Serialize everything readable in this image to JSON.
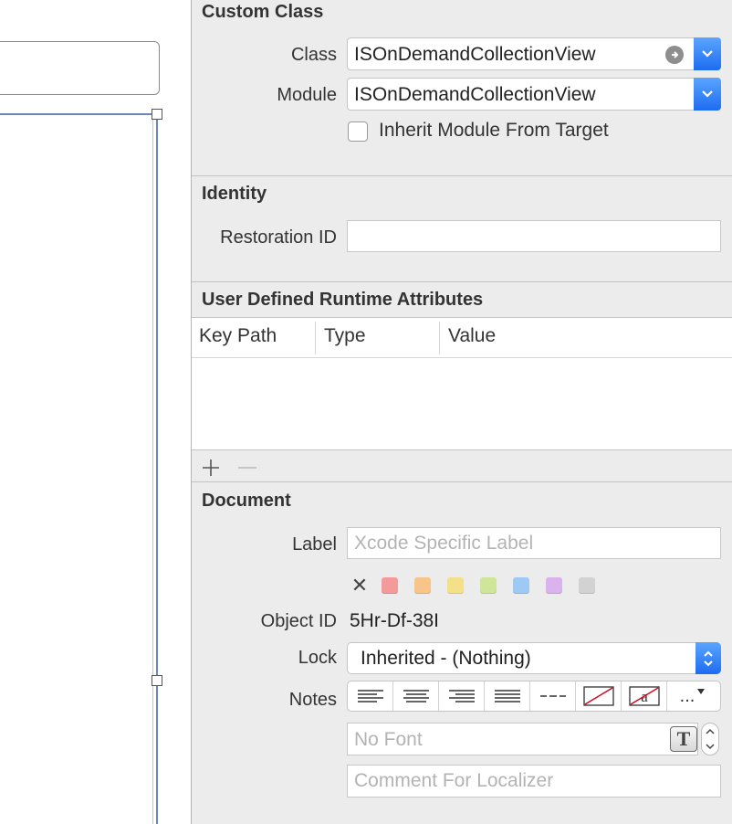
{
  "custom_class": {
    "title": "Custom Class",
    "class_label": "Class",
    "class_value": "ISOnDemandCollectionView",
    "module_label": "Module",
    "module_value": "ISOnDemandCollectionView",
    "inherit_label": "Inherit Module From Target",
    "inherit_checked": false
  },
  "identity": {
    "title": "Identity",
    "restoration_label": "Restoration ID",
    "restoration_value": ""
  },
  "runtime_attributes": {
    "title": "User Defined Runtime Attributes",
    "columns": [
      "Key Path",
      "Type",
      "Value"
    ],
    "rows": []
  },
  "document": {
    "title": "Document",
    "label_label": "Label",
    "label_placeholder": "Xcode Specific Label",
    "colors": [
      "#f39a9a",
      "#f7c48a",
      "#f5e08a",
      "#cfe59a",
      "#9ec9f5",
      "#d9b2ee",
      "#d2d2d2"
    ],
    "object_id_label": "Object ID",
    "object_id_value": "5Hr-Df-38I",
    "lock_label": "Lock",
    "lock_value": "Inherited - (Nothing)",
    "notes_label": "Notes",
    "notes_more": "...",
    "font_placeholder": "No Font",
    "comment_placeholder": "Comment For Localizer"
  },
  "accent_color": "#1d6cf0"
}
